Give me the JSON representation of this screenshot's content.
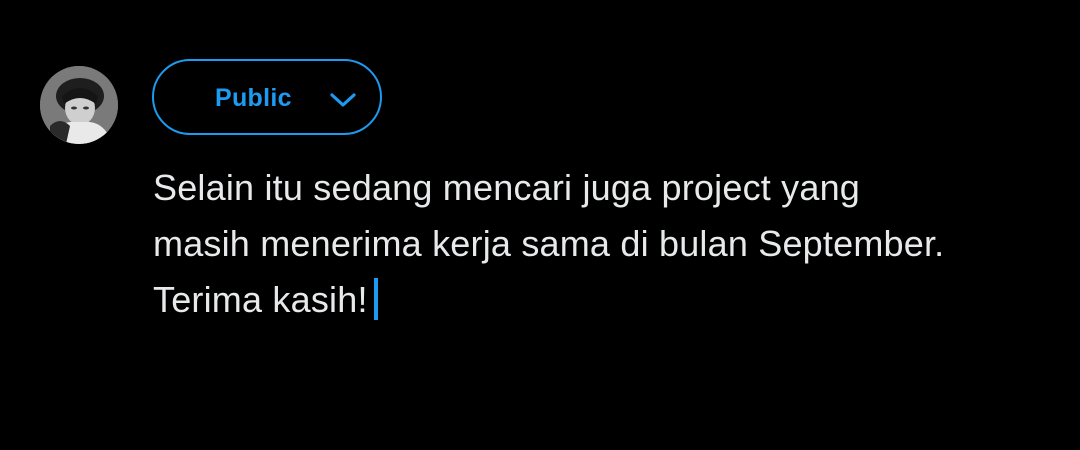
{
  "composer": {
    "avatar_icon": "user-avatar",
    "audience": {
      "label": "Public",
      "icon": "chevron-down-icon",
      "accent_color": "#1d9bf0"
    },
    "text_lines": [
      "Selain itu sedang mencari juga project yang",
      "masih menerima kerja sama di bulan September.",
      "Terima kasih!"
    ]
  },
  "colors": {
    "background": "#000000",
    "text": "#e7e9ea",
    "accent": "#1d9bf0"
  }
}
